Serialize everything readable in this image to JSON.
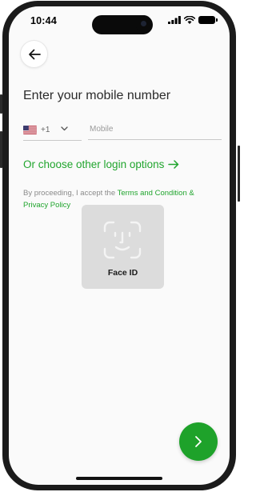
{
  "status_bar": {
    "time": "10:44",
    "signal_icon": "signal-bars-icon",
    "wifi_icon": "wifi-icon",
    "battery_icon": "battery-full-icon"
  },
  "header": {
    "back_icon": "arrow-left-icon"
  },
  "form": {
    "title": "Enter your mobile number",
    "country": {
      "flag": "us-flag-icon",
      "dial_code": "+1",
      "chevron_icon": "chevron-down-icon"
    },
    "mobile": {
      "placeholder": "Mobile",
      "value": ""
    }
  },
  "other_options": {
    "label": "Or choose other login options",
    "icon": "arrow-right-icon"
  },
  "consent": {
    "prefix": "By proceeding, I accept the ",
    "terms_link": "Terms and Condition & Privacy Policy"
  },
  "face_id": {
    "icon": "face-id-icon",
    "label": "Face ID"
  },
  "next_button": {
    "icon": "chevron-right-icon"
  },
  "colors": {
    "accent": "#21a52e",
    "button": "#1ea22a",
    "tile": "#dcdcdc"
  }
}
